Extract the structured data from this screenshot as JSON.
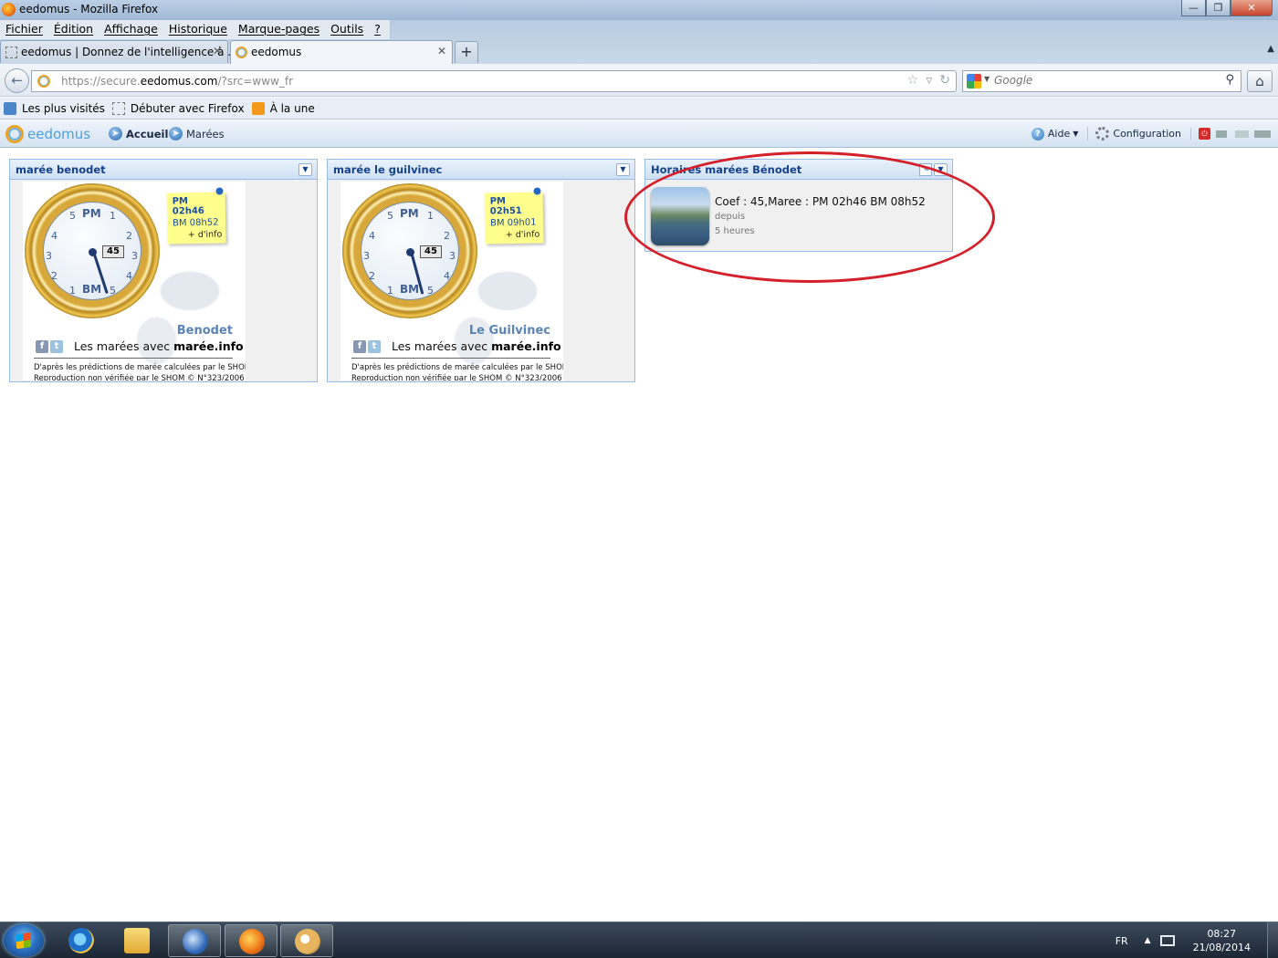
{
  "window": {
    "title": "eedomus - Mozilla Firefox"
  },
  "menubar": [
    "Fichier",
    "Édition",
    "Affichage",
    "Historique",
    "Marque-pages",
    "Outils",
    "?"
  ],
  "tabs": [
    {
      "label": "eedomus | Donnez de l'intelligence à ...",
      "active": false
    },
    {
      "label": "eedomus",
      "active": true
    }
  ],
  "navbar": {
    "url_prefix": "https://secure.",
    "url_domain": "eedomus.com",
    "url_suffix": "/?src=www_fr",
    "search_placeholder": "Google"
  },
  "bookmarks": [
    "Les plus visités",
    "Débuter avec Firefox",
    "À la une"
  ],
  "app": {
    "logo": "eedomus",
    "nav": [
      "Accueil",
      "Marées"
    ],
    "right": {
      "help": "Aide",
      "config": "Configuration"
    }
  },
  "widgets": [
    {
      "title": "marée benodet",
      "pm": "PM 02h46",
      "bm": "BM 08h52",
      "more": "+ d'info",
      "coef": "45",
      "place": "Benodet",
      "credit_prefix": "Les marées avec ",
      "credit_brand": "marée.info",
      "shom_line1": "D'après les prédictions de marée calculées par le SHOM",
      "shom_line2": "Reproduction non vérifiée par le SHOM © N°323/2006"
    },
    {
      "title": "marée le guilvinec",
      "pm": "PM 02h51",
      "bm": "BM 09h01",
      "more": "+ d'info",
      "coef": "45",
      "place": "Le Guilvinec",
      "credit_prefix": "Les marées avec ",
      "credit_brand": "marée.info",
      "shom_line1": "D'après les prédictions de marée calculées par le SHOM",
      "shom_line2": "Reproduction non vérifiée par le SHOM © N°323/2006"
    }
  ],
  "dial": {
    "pm": "PM",
    "bm": "BM"
  },
  "coef_widget": {
    "title": "Horaires marées Bénodet",
    "text": "Coef : 45,Maree : PM 02h46 BM 08h52",
    "since_word": "depuis",
    "since_value": "5 heures"
  },
  "taskbar": {
    "lang": "FR",
    "time": "08:27",
    "date": "21/08/2014"
  },
  "colors": {
    "annotation": "#d4202a",
    "widget_title": "#15428b",
    "accent": "#4aa0dc"
  }
}
